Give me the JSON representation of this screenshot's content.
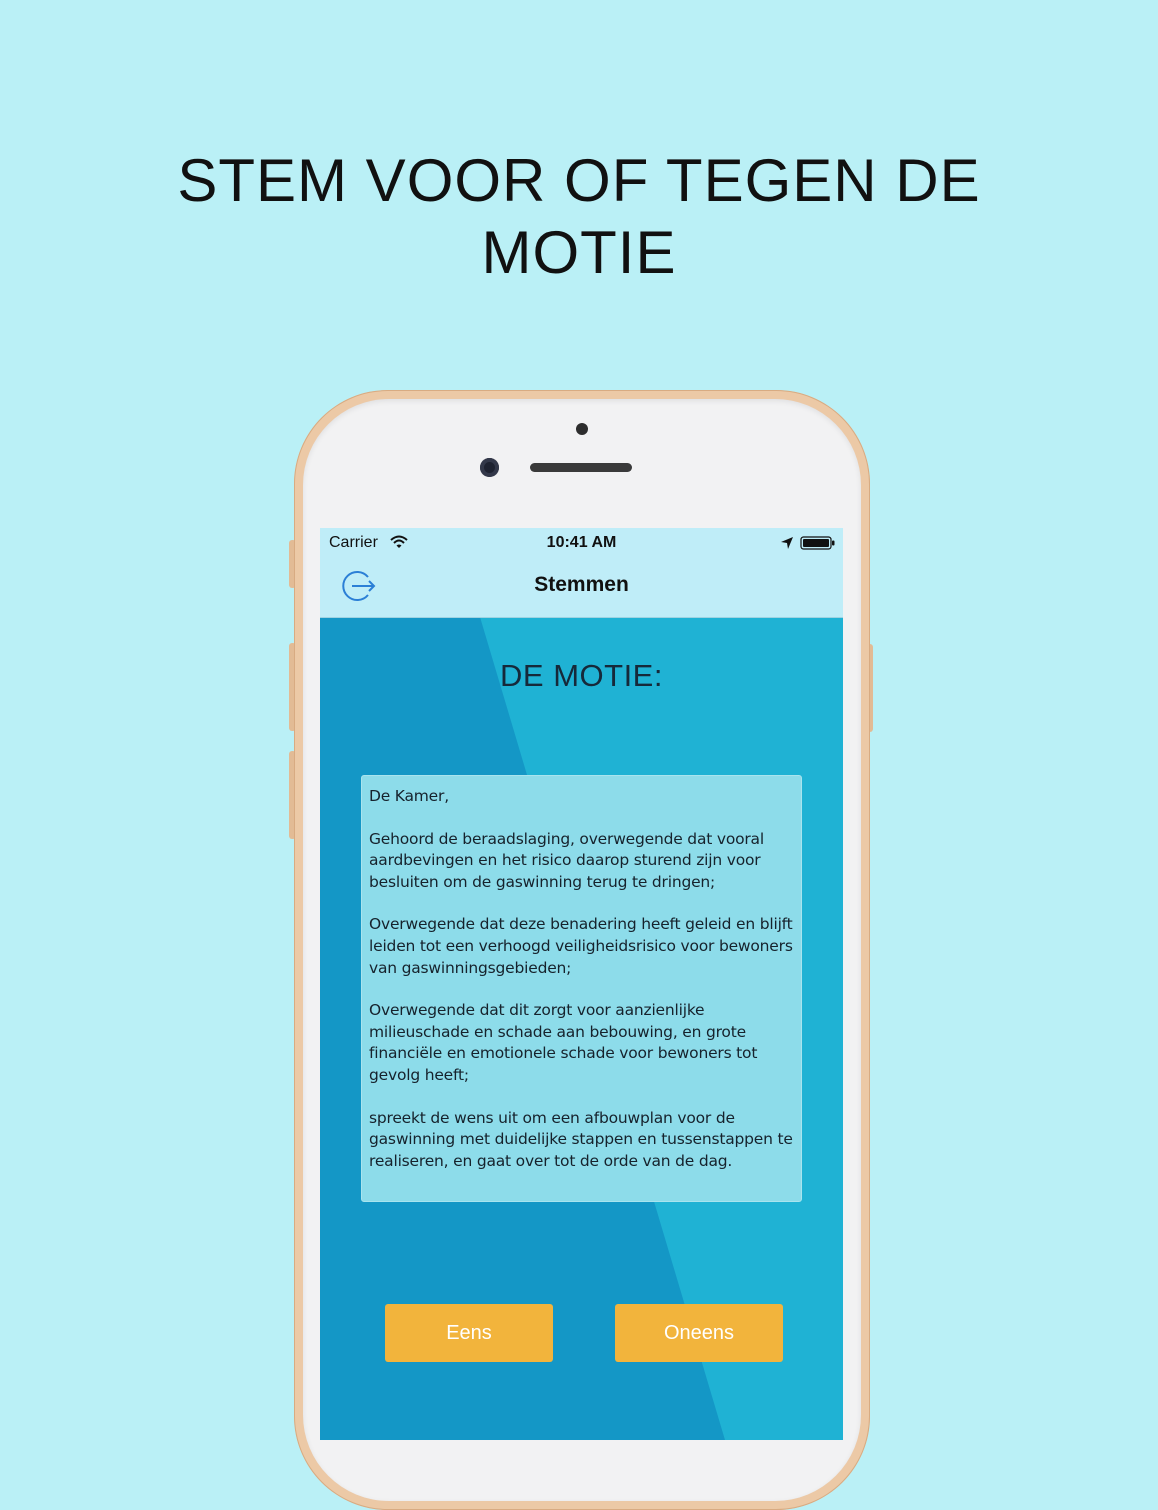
{
  "headline": {
    "line1": "STEM VOOR OF TEGEN DE",
    "line2": "MOTIE"
  },
  "status_bar": {
    "carrier": "Carrier",
    "time": "10:41 AM",
    "icons": [
      "wifi-icon",
      "location-arrow-icon",
      "battery-icon"
    ]
  },
  "navbar": {
    "title": "Stemmen",
    "left_icon": "logout-icon"
  },
  "motie": {
    "heading": "DE MOTIE:",
    "paragraphs": [
      "De Kamer,",
      "Gehoord de beraadslaging, overwegende dat vooral aardbevingen en het risico daarop sturend zijn voor besluiten om de gaswinning terug te dringen;",
      "Overwegende dat deze benadering heeft geleid en blijft leiden tot een verhoogd veiligheidsrisico voor bewoners van gaswinningsgebieden;",
      "Overwegende dat dit zorgt voor aanzienlijke milieuschade en schade aan bebouwing, en grote financiële en emotionele schade voor bewoners tot gevolg heeft;",
      "spreekt de wens uit om een afbouwplan voor de gaswinning met duidelijke stappen en tussenstappen te realiseren, en gaat over tot de orde van de dag."
    ]
  },
  "buttons": {
    "agree": "Eens",
    "disagree": "Oneens"
  },
  "colors": {
    "background": "#baf0f6",
    "screen": "#1497c6",
    "navbar": "#bfedf8",
    "button": "#f2b43c",
    "icon_accent": "#2b7fd6"
  }
}
